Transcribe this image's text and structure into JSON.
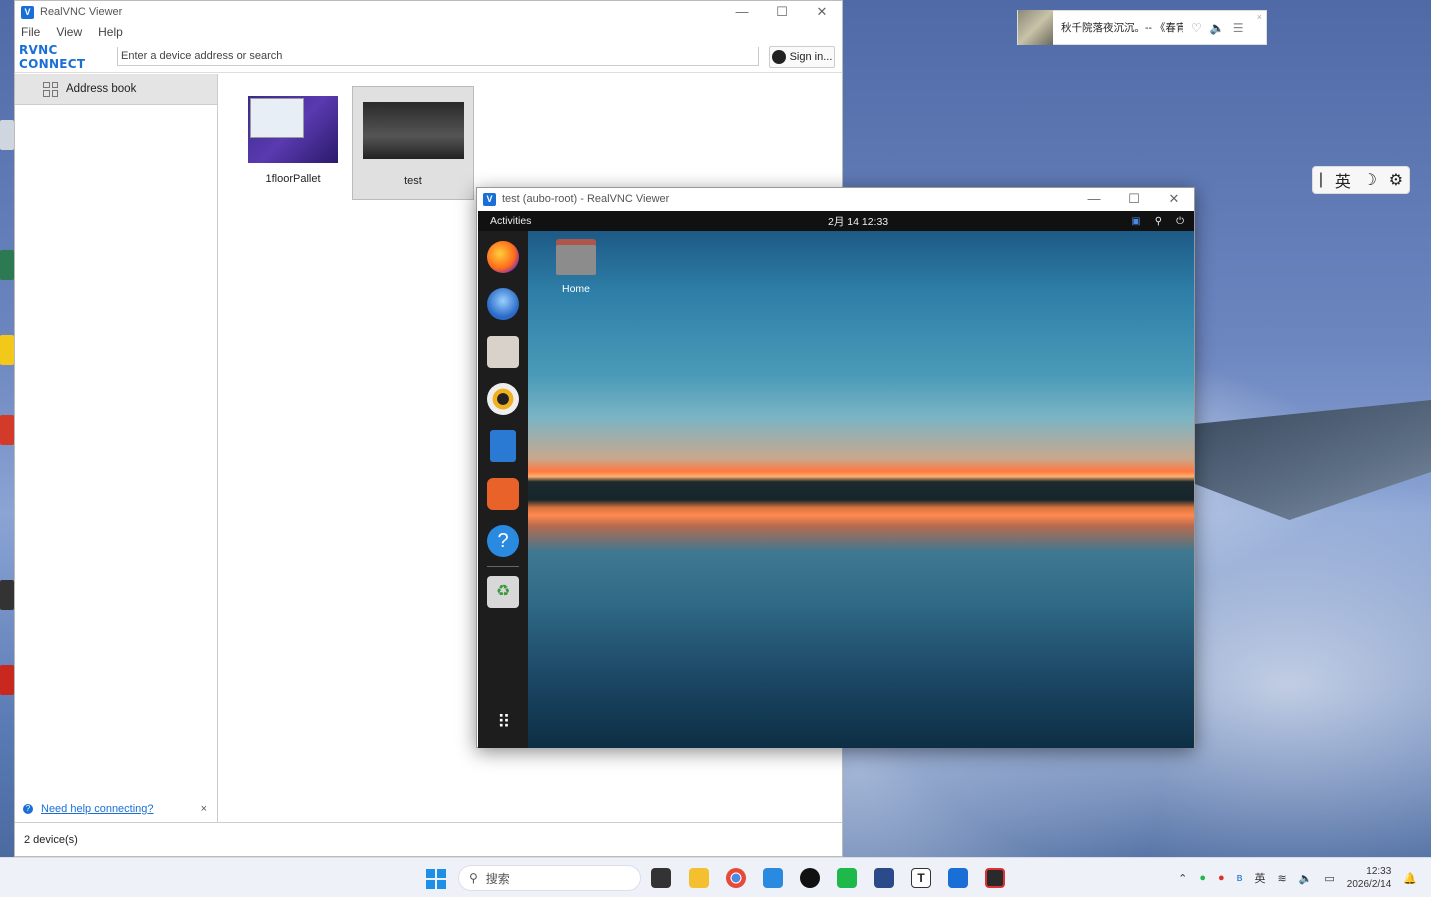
{
  "music_widget": {
    "title": "秋千院落夜沉沉。-- 《春宵",
    "heart": "♡",
    "volume": "🔈",
    "list": "☰",
    "close": "×"
  },
  "ime_bar": {
    "cursor": "|",
    "lang": "英",
    "moon": "☽",
    "gear": "⚙"
  },
  "main_window": {
    "title": "RealVNC Viewer",
    "controls": {
      "minimize": "—",
      "maximize": "☐",
      "close": "✕"
    },
    "menu": [
      "File",
      "View",
      "Help"
    ],
    "logo": "RVNC CONNECT",
    "search_placeholder": "Enter a device address or search",
    "sign_in": "Sign in...",
    "sidebar": {
      "address_book": "Address book",
      "help_link": "Need help connecting?",
      "help_close": "×"
    },
    "devices": [
      {
        "name": "1floorPallet",
        "selected": false
      },
      {
        "name": "test",
        "selected": true
      }
    ],
    "status": "2 device(s)"
  },
  "session_window": {
    "title": "test (aubo-root) - RealVNC Viewer",
    "controls": {
      "minimize": "—",
      "maximize": "☐",
      "close": "✕"
    },
    "remote": {
      "activities": "Activities",
      "clock": "2月 14  12:33",
      "home_label": "Home",
      "dock": [
        "firefox-icon",
        "thunderbird-icon",
        "files-icon",
        "rhythmbox-icon",
        "writer-icon",
        "software-icon",
        "help-icon",
        "trash-icon",
        "apps-grid-icon"
      ]
    }
  },
  "taskbar": {
    "search_placeholder": "搜索",
    "tray_lang": "英",
    "time": "12:33",
    "date": "2026/2/14"
  },
  "colors": {
    "accent": "#1a6fd6",
    "taskbar_bg": "#eef2f8"
  }
}
